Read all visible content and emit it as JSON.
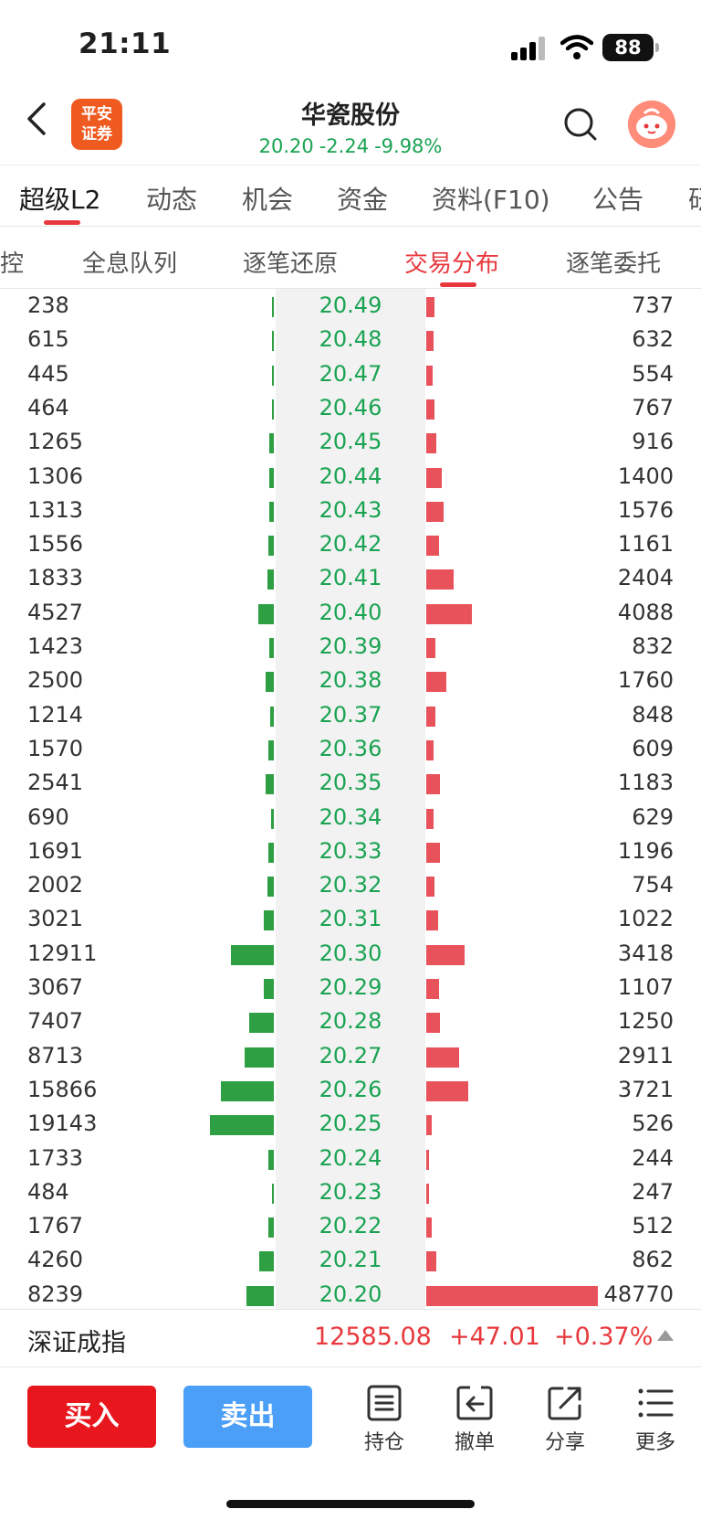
{
  "status": {
    "time": "21:11",
    "battery": "88"
  },
  "header": {
    "logo_line1": "平安",
    "logo_line2": "证券",
    "stock_name": "华瓷股份",
    "price": "20.20",
    "change": "-2.24",
    "change_pct": "-9.98%",
    "quote_color": "#1aa352"
  },
  "tabs_primary": [
    "超级L2",
    "动态",
    "机会",
    "资金",
    "资料(F10)",
    "公告",
    "研"
  ],
  "tabs_secondary": [
    "控",
    "全息队列",
    "逐笔还原",
    "交易分布",
    "逐笔委托"
  ],
  "colors": {
    "accent": "#e8383d",
    "buy_bar": "#2ea043",
    "sell_bar": "#e8525a",
    "price_text": "#1aa352"
  },
  "distribution": [
    {
      "left": "238",
      "price": "20.49",
      "right": "737"
    },
    {
      "left": "615",
      "price": "20.48",
      "right": "632"
    },
    {
      "left": "445",
      "price": "20.47",
      "right": "554"
    },
    {
      "left": "464",
      "price": "20.46",
      "right": "767"
    },
    {
      "left": "1265",
      "price": "20.45",
      "right": "916"
    },
    {
      "left": "1306",
      "price": "20.44",
      "right": "1400"
    },
    {
      "left": "1313",
      "price": "20.43",
      "right": "1576"
    },
    {
      "left": "1556",
      "price": "20.42",
      "right": "1161"
    },
    {
      "left": "1833",
      "price": "20.41",
      "right": "2404"
    },
    {
      "left": "4527",
      "price": "20.40",
      "right": "4088"
    },
    {
      "left": "1423",
      "price": "20.39",
      "right": "832"
    },
    {
      "left": "2500",
      "price": "20.38",
      "right": "1760"
    },
    {
      "left": "1214",
      "price": "20.37",
      "right": "848"
    },
    {
      "left": "1570",
      "price": "20.36",
      "right": "609"
    },
    {
      "left": "2541",
      "price": "20.35",
      "right": "1183"
    },
    {
      "left": "690",
      "price": "20.34",
      "right": "629"
    },
    {
      "left": "1691",
      "price": "20.33",
      "right": "1196"
    },
    {
      "left": "2002",
      "price": "20.32",
      "right": "754"
    },
    {
      "left": "3021",
      "price": "20.31",
      "right": "1022"
    },
    {
      "left": "12911",
      "price": "20.30",
      "right": "3418"
    },
    {
      "left": "3067",
      "price": "20.29",
      "right": "1107"
    },
    {
      "left": "7407",
      "price": "20.28",
      "right": "1250"
    },
    {
      "left": "8713",
      "price": "20.27",
      "right": "2911"
    },
    {
      "left": "15866",
      "price": "20.26",
      "right": "3721"
    },
    {
      "left": "19143",
      "price": "20.25",
      "right": "526"
    },
    {
      "left": "1733",
      "price": "20.24",
      "right": "244"
    },
    {
      "left": "484",
      "price": "20.23",
      "right": "247"
    },
    {
      "left": "1767",
      "price": "20.22",
      "right": "512"
    },
    {
      "left": "4260",
      "price": "20.21",
      "right": "862"
    },
    {
      "left": "8239",
      "price": "20.20",
      "right": "48770"
    }
  ],
  "index": {
    "name": "深证成指",
    "value": "12585.08",
    "change": "+47.01",
    "change_pct": "+0.37%"
  },
  "bottom": {
    "buy_label": "买入",
    "sell_label": "卖出",
    "tools": [
      {
        "icon": "position-icon",
        "label": "持仓"
      },
      {
        "icon": "cancel-order-icon",
        "label": "撤单"
      },
      {
        "icon": "share-icon",
        "label": "分享"
      },
      {
        "icon": "more-icon",
        "label": "更多"
      }
    ]
  }
}
